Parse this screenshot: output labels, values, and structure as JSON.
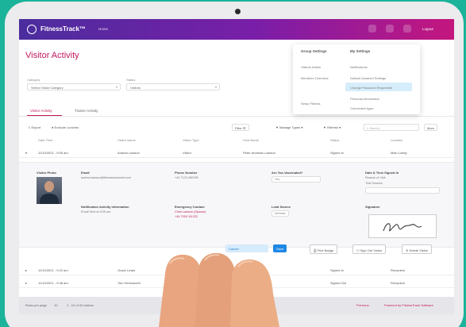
{
  "app": {
    "name": "FitnessTrack™",
    "menu_label": "Home",
    "user_label": "Logout"
  },
  "page": {
    "title": "Visitor Activity"
  },
  "filters": [
    {
      "label": "Category",
      "value": "Select Visitor Category"
    },
    {
      "label": "Status",
      "value": "Visitors"
    }
  ],
  "dropdown": {
    "col1": {
      "heading": "Group Settings",
      "items": [
        "Visitors Admin",
        "Members Overview",
        "Setup Fitness"
      ]
    },
    "col2": {
      "heading": "My Settings",
      "items": [
        "Notifications",
        "Default Unsaved Settings",
        "Change Password Requested",
        "Personal Information",
        "Connected Apps"
      ]
    }
  },
  "tabs": [
    "Visitor Activity",
    "Trainer Activity"
  ],
  "toolbar": {
    "export": "Export",
    "exclude": "Exclude Lunches",
    "filter": "Filter",
    "manage": "Manage Types",
    "saved": "Refresh",
    "search": "Search...",
    "more": "More"
  },
  "table": {
    "headers": [
      "Date Time",
      "Visitor Name",
      "Visitor Type",
      "Host Name",
      "Status",
      "Location"
    ],
    "rows": [
      [
        "11/10/2021 - 9:05 am",
        "Andrea Lawson",
        "Visitor",
        "Peter Andrews Lawson",
        "Signed In",
        "Main Lobby"
      ],
      [
        "11/10/2021 - 9:22 am",
        "Grace Lewis",
        "Contractor",
        "Angela Shaw",
        "Signed In",
        "Reception"
      ],
      [
        "11/10/2021 - 9:48 am",
        "Tom Hemsworth",
        "Visitor",
        "Luke Mayer",
        "Signed Out",
        "Reception"
      ]
    ]
  },
  "detail": {
    "visitor_photo_label": "Visitor Photo",
    "email_label": "Email",
    "email_value": "andrea.lawson@fitnesstrackmail.com",
    "phone_label": "Phone Number",
    "phone_value": "+44 7123 456789",
    "dob_label": "Are You Vaccinated?",
    "dob_value": "Yes",
    "date_label": "Date & Time Signed In",
    "date_value1": "Reason of Visit",
    "date_value2": "Trial Session",
    "notif_label": "Notification Activity Information",
    "notif_value": "Email Sent at 9:05 am",
    "emergency_label": "Emergency Contact",
    "emergency_value1": "Chris Lawson (Spouse)",
    "emergency_value2": "+44 7000 111222",
    "lead_label": "Lead Source",
    "lead_value": "Website",
    "signature_label": "Signature"
  },
  "actions": {
    "cancel": "Cancel",
    "save": "Save",
    "print": "Print Badge",
    "sign_out": "Sign Out Visitor",
    "delete": "Delete Visitor"
  },
  "footer": {
    "rows_label": "Rows per page",
    "rows_value": "10",
    "range": "1 - 10 of 34 visitors",
    "page_prev": "Previous",
    "page_next": "Next",
    "powered": "Powered by FitnessTrack Software"
  }
}
